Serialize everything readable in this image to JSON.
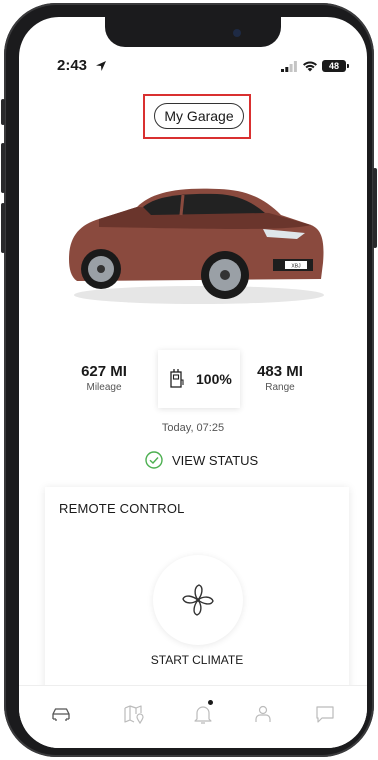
{
  "status_bar": {
    "time": "2:43",
    "battery": "48"
  },
  "header": {
    "garage_label": "My Garage"
  },
  "vehicle": {
    "image_icon": "car-image",
    "plate": "XBJ"
  },
  "stats": {
    "mileage": {
      "value": "627 MI",
      "label": "Mileage"
    },
    "charge": {
      "value": "100%"
    },
    "range": {
      "value": "483 MI",
      "label": "Range"
    },
    "updated": "Today, 07:25"
  },
  "view_status": {
    "label": "VIEW STATUS"
  },
  "remote_control": {
    "title": "REMOTE CONTROL",
    "climate_label": "START CLIMATE"
  },
  "tabs": [
    {
      "icon": "car-icon"
    },
    {
      "icon": "map-icon"
    },
    {
      "icon": "bell-icon"
    },
    {
      "icon": "profile-icon"
    },
    {
      "icon": "chat-icon"
    }
  ],
  "colors": {
    "highlight": "#d93030",
    "car_body": "#8a4a3e",
    "check": "#4caf50"
  }
}
